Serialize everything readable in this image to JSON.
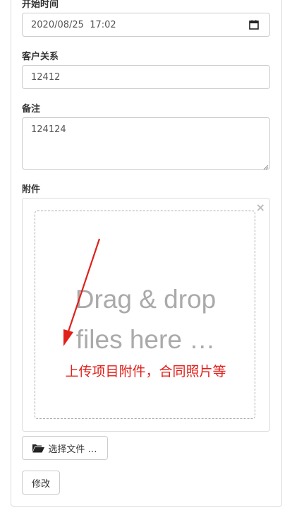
{
  "form": {
    "start_time_label": "开始时间",
    "start_time_value": "2020/08/25  17:02",
    "customer_relation_label": "客户关系",
    "customer_relation_value": "12412",
    "remark_label": "备注",
    "remark_value": "124124",
    "attachment_label": "附件"
  },
  "upload": {
    "close_glyph": "×",
    "drop_line1": "Drag & drop",
    "drop_line2": "files here …",
    "annotation": "上传项目附件，合同照片等",
    "choose_button_label": "选择文件 …"
  },
  "actions": {
    "submit_label": "修改"
  },
  "colors": {
    "annotation": "#e0201a",
    "border": "#cccccc"
  }
}
